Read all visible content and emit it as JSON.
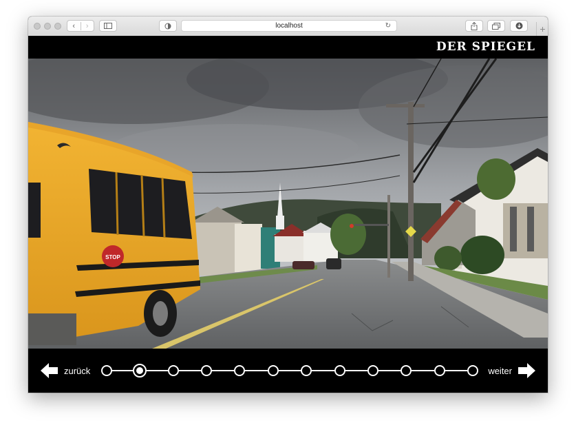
{
  "browser": {
    "address": "localhost",
    "reload_icon": "↻"
  },
  "brand": {
    "logo": "DER SPIEGEL"
  },
  "photo": {
    "bus_sign": "STOP"
  },
  "navigation": {
    "prev_label": "zurück",
    "next_label": "weiter",
    "slide_count": 12,
    "active_slide": 2
  }
}
